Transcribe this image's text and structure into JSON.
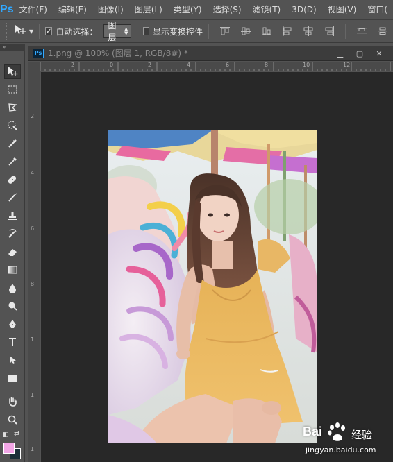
{
  "app": {
    "logo": "Ps"
  },
  "menu": [
    "文件(F)",
    "编辑(E)",
    "图像(I)",
    "图层(L)",
    "类型(Y)",
    "选择(S)",
    "滤镜(T)",
    "3D(D)",
    "视图(V)",
    "窗口("
  ],
  "options": {
    "auto_select_label": "自动选择：",
    "auto_select_checked": true,
    "layer_select_value": "图层",
    "show_transform_label": "显示变换控件",
    "show_transform_checked": false
  },
  "document": {
    "title": "1.png @ 100% (图层 1, RGB/8#) *",
    "tab_icon": "Ps"
  },
  "ruler": {
    "top_ticks": [
      "2",
      "0",
      "2",
      "4",
      "6",
      "8",
      "10",
      "12"
    ],
    "left_ticks": [
      "2",
      "4",
      "6",
      "8",
      "1",
      "1",
      "1"
    ]
  },
  "colors": {
    "foreground": "#f2a6e6",
    "background": "#1a2e38",
    "ps_blue": "#31a8ff"
  },
  "watermark": {
    "brand": "Bai",
    "product": "经验",
    "url": "jingyan.baidu.com"
  },
  "tools": [
    "move-tool",
    "marquee-tool",
    "lasso-tool",
    "quick-selection-tool",
    "crop-tool",
    "eyedropper-tool",
    "spot-healing-tool",
    "brush-tool",
    "clone-stamp-tool",
    "history-brush-tool",
    "eraser-tool",
    "gradient-tool",
    "blur-tool",
    "dodge-tool",
    "pen-tool",
    "type-tool",
    "path-selection-tool",
    "rectangle-tool",
    "hand-tool",
    "zoom-tool"
  ]
}
